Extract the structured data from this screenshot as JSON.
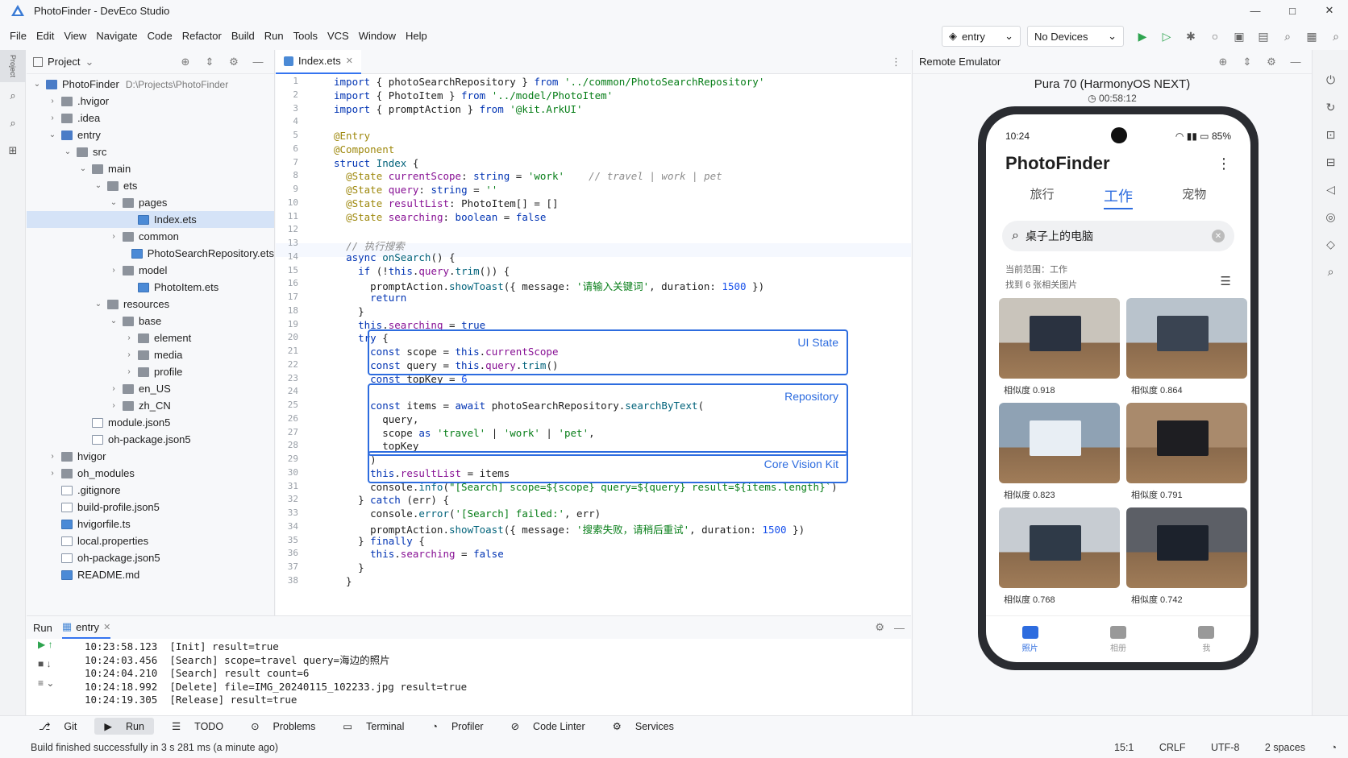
{
  "window": {
    "title": "PhotoFinder - DevEco Studio",
    "min": "—",
    "max": "□",
    "close": "✕"
  },
  "menu": [
    "File",
    "Edit",
    "View",
    "Navigate",
    "Code",
    "Refactor",
    "Build",
    "Run",
    "Tools",
    "VCS",
    "Window",
    "Help"
  ],
  "toolbar": {
    "config": "entry",
    "devices": "No Devices"
  },
  "project": {
    "header": "Project",
    "tree": [
      {
        "d": 0,
        "a": "v",
        "t": "fold",
        "blue": true,
        "label": "PhotoFinder",
        "path": "D:\\Projects\\PhotoFinder"
      },
      {
        "d": 1,
        "a": ">",
        "t": "fold",
        "label": ".hvigor"
      },
      {
        "d": 1,
        "a": ">",
        "t": "fold",
        "label": ".idea"
      },
      {
        "d": 1,
        "a": "v",
        "t": "fold",
        "blue": true,
        "label": "entry"
      },
      {
        "d": 2,
        "a": "v",
        "t": "fold",
        "label": "src"
      },
      {
        "d": 3,
        "a": "v",
        "t": "fold",
        "label": "main"
      },
      {
        "d": 4,
        "a": "v",
        "t": "fold",
        "label": "ets"
      },
      {
        "d": 5,
        "a": "v",
        "t": "fold",
        "label": "pages"
      },
      {
        "d": 6,
        "a": "",
        "t": "ets",
        "label": "Index.ets",
        "sel": true
      },
      {
        "d": 5,
        "a": ">",
        "t": "fold",
        "label": "common"
      },
      {
        "d": 6,
        "a": "",
        "t": "ets",
        "label": "PhotoSearchRepository.ets"
      },
      {
        "d": 5,
        "a": ">",
        "t": "fold",
        "label": "model"
      },
      {
        "d": 6,
        "a": "",
        "t": "ets",
        "label": "PhotoItem.ets"
      },
      {
        "d": 4,
        "a": "v",
        "t": "fold",
        "label": "resources"
      },
      {
        "d": 5,
        "a": "v",
        "t": "fold",
        "label": "base"
      },
      {
        "d": 6,
        "a": ">",
        "t": "fold",
        "label": "element"
      },
      {
        "d": 6,
        "a": ">",
        "t": "fold",
        "label": "media"
      },
      {
        "d": 6,
        "a": ">",
        "t": "fold",
        "label": "profile"
      },
      {
        "d": 5,
        "a": ">",
        "t": "fold",
        "label": "en_US"
      },
      {
        "d": 5,
        "a": ">",
        "t": "fold",
        "label": "zh_CN"
      },
      {
        "d": 3,
        "a": "",
        "t": "file",
        "label": "module.json5"
      },
      {
        "d": 3,
        "a": "",
        "t": "file",
        "label": "oh-package.json5"
      },
      {
        "d": 1,
        "a": ">",
        "t": "fold",
        "label": "hvigor"
      },
      {
        "d": 1,
        "a": ">",
        "t": "fold",
        "label": "oh_modules"
      },
      {
        "d": 1,
        "a": "",
        "t": "file",
        "label": ".gitignore"
      },
      {
        "d": 1,
        "a": "",
        "t": "file",
        "label": "build-profile.json5"
      },
      {
        "d": 1,
        "a": "",
        "t": "ets",
        "label": "hvigorfile.ts"
      },
      {
        "d": 1,
        "a": "",
        "t": "file",
        "label": "local.properties"
      },
      {
        "d": 1,
        "a": "",
        "t": "file",
        "label": "oh-package.json5"
      },
      {
        "d": 1,
        "a": "",
        "t": "ets",
        "label": "README.md"
      }
    ]
  },
  "editor": {
    "tab": "Index.ets",
    "lines": [
      "<span class='kw'>import</span> { photoSearchRepository } <span class='kw'>from</span> <span class='str'>'../common/PhotoSearchRepository'</span>",
      "<span class='kw'>import</span> { PhotoItem } <span class='kw'>from</span> <span class='str'>'../model/PhotoItem'</span>",
      "<span class='kw'>import</span> { promptAction } <span class='kw'>from</span> <span class='str'>'@kit.ArkUI'</span>",
      "",
      "<span class='an'>@Entry</span>",
      "<span class='an'>@Component</span>",
      "<span class='kw'>struct</span> <span class='fn'>Index</span> {",
      "  <span class='an'>@State</span> <span class='pr'>currentScope</span>: <span class='ty'>string</span> = <span class='str'>'work'</span>    <span class='cm'>// travel | work | pet</span>",
      "  <span class='an'>@State</span> <span class='pr'>query</span>: <span class='ty'>string</span> = <span class='str'>''</span>",
      "  <span class='an'>@State</span> <span class='pr'>resultList</span>: PhotoItem[] = []",
      "  <span class='an'>@State</span> <span class='pr'>searching</span>: <span class='ty'>boolean</span> = <span class='kw'>false</span>",
      "",
      "  <span class='cm'>// 执行搜索</span>",
      "  <span class='kw'>async</span> <span class='fn'>onSearch</span>() {",
      "    <span class='kw'>if</span> (!<span class='kw'>this</span>.<span class='pr'>query</span>.<span class='fn'>trim</span>()) {",
      "      promptAction.<span class='fn'>showToast</span>({ message: <span class='str'>'请输入关键词'</span>, duration: <span class='num'>1500</span> })",
      "      <span class='kw'>return</span>",
      "    }",
      "    <span class='kw'>this</span>.<span class='pr'>searching</span> = <span class='kw'>true</span>",
      "    <span class='kw'>try</span> {",
      "      <span class='kw'>const</span> scope = <span class='kw'>this</span>.<span class='pr'>currentScope</span>",
      "      <span class='kw'>const</span> query = <span class='kw'>this</span>.<span class='pr'>query</span>.<span class='fn'>trim</span>()",
      "      <span class='kw'>const</span> topKey = <span class='num'>6</span>",
      "",
      "      <span class='kw'>const</span> items = <span class='kw'>await</span> photoSearchRepository.<span class='fn'>searchByText</span>(",
      "        query,",
      "        scope <span class='kw'>as</span> <span class='str'>'travel'</span> | <span class='str'>'work'</span> | <span class='str'>'pet'</span>,",
      "        topKey",
      "      )",
      "      <span class='kw'>this</span>.<span class='pr'>resultList</span> = items",
      "      console.<span class='fn'>info</span>(<span class='str'>\"[Search] scope=${scope} query=${query} result=${items.length}`</span>)",
      "    } <span class='kw'>catch</span> (err) {",
      "      console.<span class='fn'>error</span>(<span class='str'>'[Search] failed:'</span>, err)",
      "      promptAction.<span class='fn'>showToast</span>({ message: <span class='str'>'搜索失败，请稍后重试'</span>, duration: <span class='num'>1500</span> })",
      "    } <span class='kw'>finally</span> {",
      "      <span class='kw'>this</span>.<span class='pr'>searching</span> = <span class='kw'>false</span>",
      "    }",
      "  }"
    ],
    "callouts": [
      "UI State",
      "Repository",
      "Core Vision Kit"
    ]
  },
  "emulator": {
    "header": "Remote Emulator",
    "device": "Pura 70 (HarmonyOS NEXT)",
    "time": "00:58:12",
    "status_time": "10:24",
    "battery": "85%",
    "app_title": "PhotoFinder",
    "tabs": [
      "旅行",
      "工作",
      "宠物"
    ],
    "query": "桌子上的电脑",
    "scope_text": "当前范围：工作",
    "found_text": "找到 6 张相关图片",
    "results": [
      {
        "sim": "相似度 0.918",
        "bg": "#c9c4bb",
        "scr": "#2a3240"
      },
      {
        "sim": "相似度 0.864",
        "bg": "#b9c3cc",
        "scr": "#3a4452"
      },
      {
        "sim": "相似度 0.823",
        "bg": "#8fa2b4",
        "scr": "#e8eef4"
      },
      {
        "sim": "相似度 0.791",
        "bg": "#a98a6c",
        "scr": "#1e1e22"
      },
      {
        "sim": "相似度 0.768",
        "bg": "#c7ccd2",
        "scr": "#2f3a48"
      },
      {
        "sim": "相似度 0.742",
        "bg": "#5c5f66",
        "scr": "#1c222c"
      }
    ],
    "nav": [
      "照片",
      "相册",
      "我"
    ]
  },
  "run": {
    "label": "Run",
    "tab": "entry",
    "log": [
      "10:23:58.123  [Init] result=true",
      "10:24:03.456  [Search] scope=travel query=海边的照片",
      "10:24:04.210  [Search] result count=6",
      "10:24:18.992  [Delete] file=IMG_20240115_102233.jpg result=true",
      "10:24:19.305  [Release] result=true"
    ]
  },
  "bottom": [
    "Git",
    "Run",
    "TODO",
    "Problems",
    "Terminal",
    "Profiler",
    "Code Linter",
    "Services"
  ],
  "status": {
    "msg": "Build finished successfully in 3 s 281 ms (a minute ago)",
    "pos": "15:1",
    "eol": "CRLF",
    "enc": "UTF-8",
    "indent": "2 spaces"
  },
  "side_label": "Project"
}
